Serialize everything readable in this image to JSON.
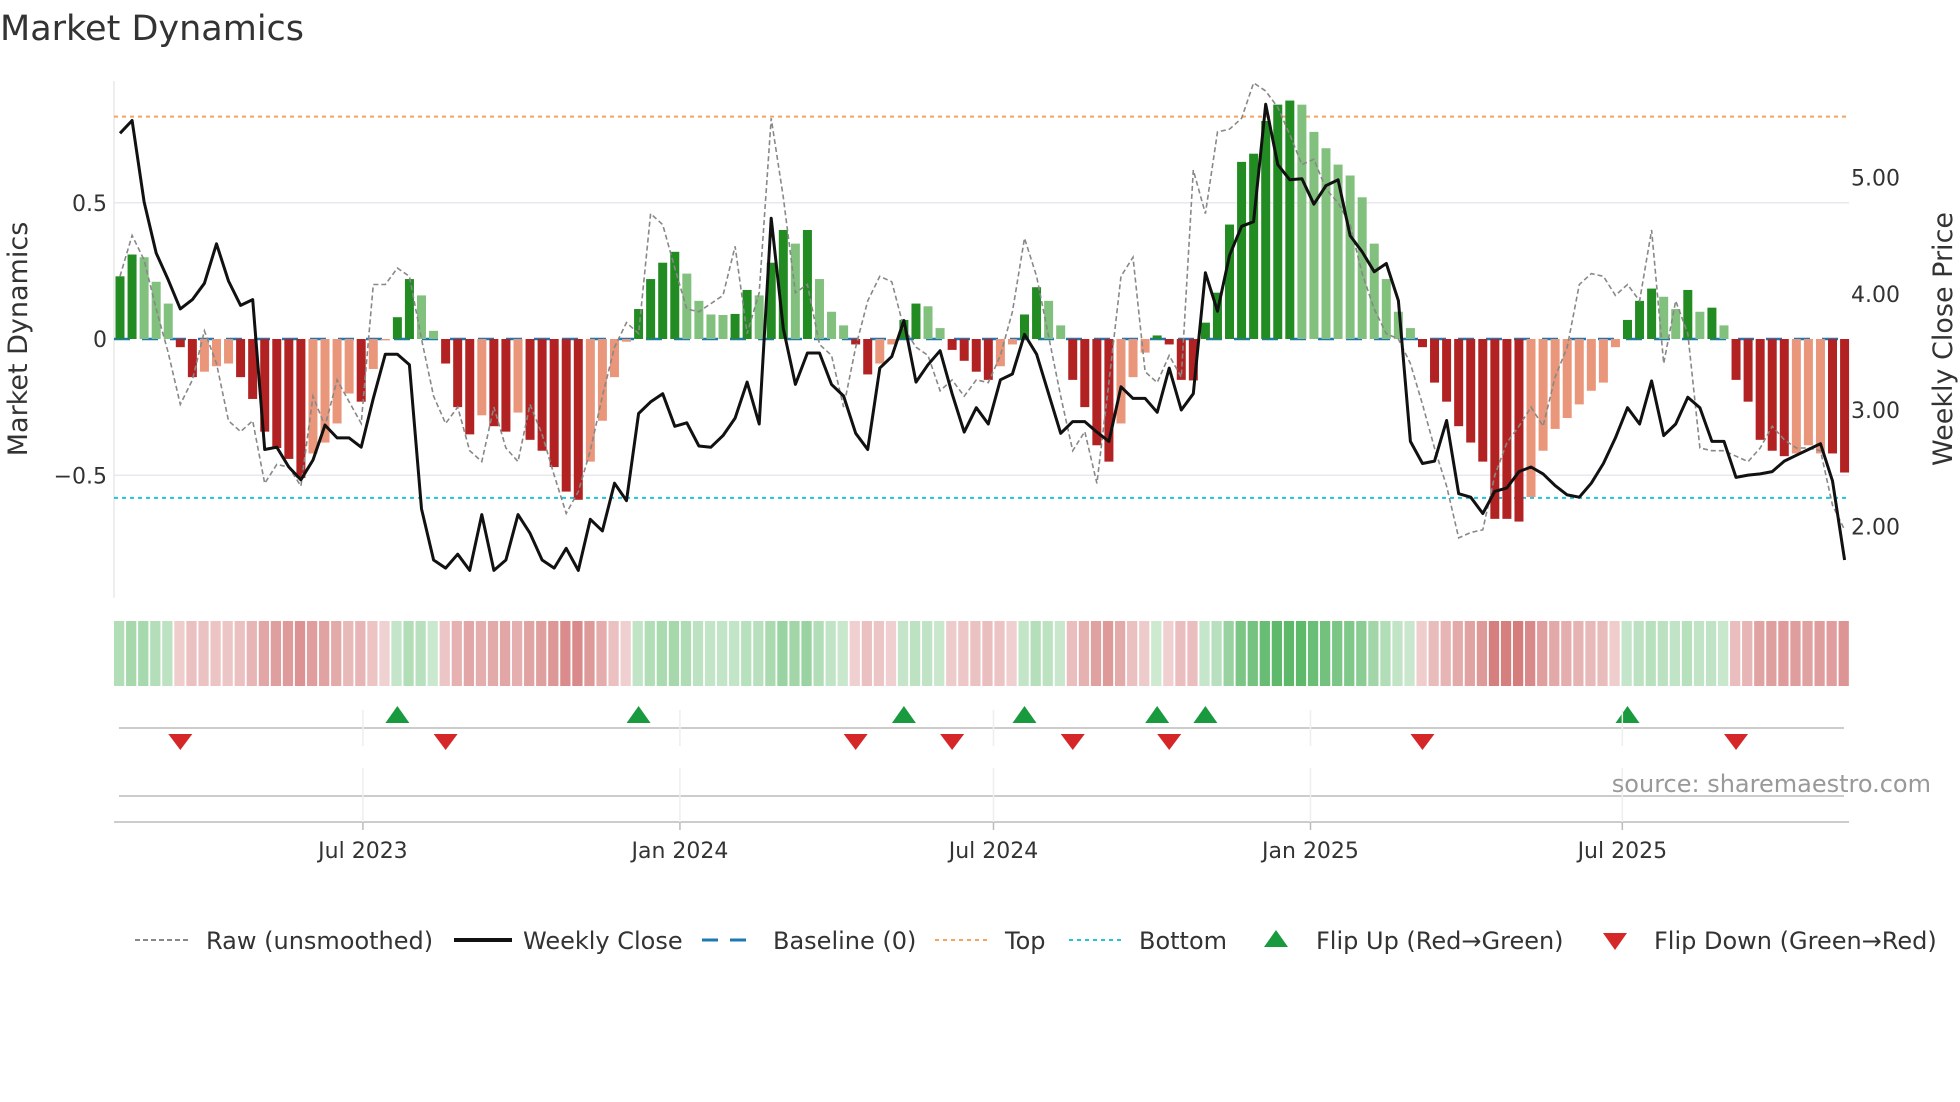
{
  "chart_data": {
    "type": "bar",
    "title": "Market Dynamics",
    "ylabel": "Market Dynamics",
    "y2label": "Weekly Close Price",
    "ylim": [
      -0.95,
      0.95
    ],
    "y2lim": [
      1.5,
      5.9
    ],
    "x_start": "2023-02-10",
    "x_step_days": 7,
    "y_ticks": [
      {
        "v": 0.5,
        "label": "0.5"
      },
      {
        "v": 0,
        "label": "0"
      },
      {
        "v": -0.5,
        "label": "−0.5"
      }
    ],
    "y2_ticks": [
      {
        "v": 5,
        "label": "5.00"
      },
      {
        "v": 4,
        "label": "4.00"
      },
      {
        "v": 3,
        "label": "3.00"
      },
      {
        "v": 2,
        "label": "2.00"
      }
    ],
    "x_ticks": [
      {
        "date": "2023-07-01",
        "label": "Jul 2023"
      },
      {
        "date": "2024-01-01",
        "label": "Jan 2024"
      },
      {
        "date": "2024-07-01",
        "label": "Jul 2024"
      },
      {
        "date": "2025-01-01",
        "label": "Jan 2025"
      },
      {
        "date": "2025-07-01",
        "label": "Jul 2025"
      }
    ],
    "top_level": 0.816,
    "bottom_level": -0.583,
    "baseline": 0,
    "momentum": [
      0.23,
      0.31,
      0.3,
      0.21,
      0.13,
      -0.03,
      -0.14,
      -0.12,
      -0.1,
      -0.09,
      -0.14,
      -0.22,
      -0.34,
      -0.4,
      -0.44,
      -0.51,
      -0.42,
      -0.38,
      -0.31,
      -0.2,
      -0.23,
      -0.11,
      -0.005,
      0.08,
      0.22,
      0.16,
      0.03,
      -0.09,
      -0.25,
      -0.35,
      -0.28,
      -0.32,
      -0.34,
      -0.27,
      -0.37,
      -0.41,
      -0.47,
      -0.56,
      -0.59,
      -0.45,
      -0.3,
      -0.14,
      -0.01,
      0.11,
      0.22,
      0.28,
      0.32,
      0.24,
      0.14,
      0.09,
      0.088,
      0.092,
      0.18,
      0.16,
      0.28,
      0.4,
      0.35,
      0.4,
      0.22,
      0.1,
      0.05,
      -0.02,
      -0.13,
      -0.09,
      -0.02,
      0.07,
      0.13,
      0.12,
      0.04,
      -0.04,
      -0.08,
      -0.12,
      -0.15,
      -0.1,
      -0.02,
      0.09,
      0.19,
      0.14,
      0.05,
      -0.15,
      -0.25,
      -0.39,
      -0.45,
      -0.31,
      -0.14,
      -0.05,
      0.013,
      -0.02,
      -0.15,
      -0.152,
      0.06,
      0.17,
      0.42,
      0.65,
      0.68,
      0.8,
      0.86,
      0.875,
      0.86,
      0.76,
      0.7,
      0.64,
      0.6,
      0.52,
      0.35,
      0.22,
      0.1,
      0.04,
      -0.03,
      -0.16,
      -0.23,
      -0.32,
      -0.38,
      -0.45,
      -0.66,
      -0.66,
      -0.67,
      -0.58,
      -0.41,
      -0.33,
      -0.29,
      -0.24,
      -0.19,
      -0.16,
      -0.03,
      0.07,
      0.14,
      0.185,
      0.155,
      0.11,
      0.18,
      0.1,
      0.115,
      0.05,
      -0.15,
      -0.23,
      -0.37,
      -0.41,
      -0.43,
      -0.42,
      -0.39,
      -0.42,
      -0.42,
      -0.49
    ],
    "shade": "DDLLLDDLLLDDDDDDLLLLDLLDDLLDDDLDDLDDDDDLLLLDDDDLLLLDDLDDLDLLLDDLLDDLLDDDDLLDDLLDDDDLLLDDDDDDDDDDDDLLLLLLLLLLDDDDDDDDDLLLLLLLLDDDLLDLDLDDDDDLLLDD",
    "raw": [
      0.23,
      0.38,
      0.29,
      0.11,
      -0.05,
      -0.24,
      -0.15,
      0.03,
      -0.09,
      -0.3,
      -0.34,
      -0.3,
      -0.53,
      -0.46,
      -0.47,
      -0.54,
      -0.21,
      -0.32,
      -0.15,
      -0.23,
      -0.31,
      0.2,
      0.2,
      0.26,
      0.23,
      0.0,
      -0.21,
      -0.31,
      -0.25,
      -0.41,
      -0.45,
      -0.25,
      -0.4,
      -0.45,
      -0.24,
      -0.35,
      -0.5,
      -0.64,
      -0.56,
      -0.41,
      -0.21,
      -0.03,
      0.06,
      0.02,
      0.46,
      0.42,
      0.26,
      0.11,
      0.1,
      0.13,
      0.16,
      0.34,
      0.02,
      0.17,
      0.81,
      0.52,
      0.17,
      0.2,
      -0.02,
      -0.06,
      -0.25,
      -0.03,
      0.14,
      0.23,
      0.21,
      0.04,
      -0.03,
      -0.06,
      -0.19,
      -0.15,
      -0.21,
      -0.15,
      -0.16,
      -0.06,
      0.1,
      0.37,
      0.23,
      0.01,
      -0.21,
      -0.41,
      -0.34,
      -0.53,
      -0.16,
      0.23,
      0.3,
      -0.12,
      -0.16,
      -0.06,
      -0.14,
      0.62,
      0.46,
      0.76,
      0.77,
      0.81,
      0.94,
      0.91,
      0.85,
      0.75,
      0.64,
      0.66,
      0.55,
      0.5,
      0.42,
      0.24,
      0.11,
      0.02,
      0.0,
      -0.09,
      -0.24,
      -0.4,
      -0.54,
      -0.73,
      -0.71,
      -0.7,
      -0.5,
      -0.38,
      -0.32,
      -0.25,
      -0.32,
      -0.14,
      -0.03,
      0.2,
      0.24,
      0.23,
      0.16,
      0.2,
      0.14,
      0.4,
      -0.09,
      0.14,
      0.02,
      -0.4,
      -0.41,
      -0.41,
      -0.43,
      -0.45,
      -0.4,
      -0.32,
      -0.37,
      -0.4,
      -0.4,
      -0.41,
      -0.61,
      -0.7
    ],
    "weekly_close": [
      5.38,
      5.49,
      4.79,
      4.35,
      4.12,
      3.87,
      3.95,
      4.09,
      4.43,
      4.11,
      3.9,
      3.95,
      2.66,
      2.68,
      2.51,
      2.4,
      2.57,
      2.87,
      2.76,
      2.76,
      2.68,
      3.1,
      3.48,
      3.48,
      3.39,
      2.15,
      1.71,
      1.64,
      1.76,
      1.62,
      2.1,
      1.62,
      1.71,
      2.1,
      1.94,
      1.71,
      1.64,
      1.81,
      1.62,
      2.06,
      1.96,
      2.37,
      2.22,
      2.97,
      3.07,
      3.14,
      2.86,
      2.89,
      2.69,
      2.68,
      2.78,
      2.93,
      3.24,
      2.88,
      4.65,
      3.7,
      3.22,
      3.49,
      3.49,
      3.22,
      3.12,
      2.8,
      2.66,
      3.36,
      3.46,
      3.77,
      3.24,
      3.39,
      3.51,
      3.14,
      2.81,
      3.02,
      2.88,
      3.26,
      3.31,
      3.65,
      3.48,
      3.14,
      2.8,
      2.9,
      2.9,
      2.81,
      2.73,
      3.2,
      3.1,
      3.1,
      2.98,
      3.36,
      3.0,
      3.14,
      4.18,
      3.85,
      4.33,
      4.58,
      4.62,
      5.63,
      5.11,
      4.98,
      4.99,
      4.77,
      4.93,
      4.98,
      4.5,
      4.36,
      4.19,
      4.26,
      3.94,
      2.73,
      2.54,
      2.56,
      2.91,
      2.28,
      2.25,
      2.11,
      2.3,
      2.33,
      2.47,
      2.51,
      2.45,
      2.35,
      2.27,
      2.25,
      2.37,
      2.54,
      2.76,
      3.02,
      2.88,
      3.25,
      2.78,
      2.88,
      3.11,
      3.02,
      2.73,
      2.73,
      2.42,
      2.44,
      2.45,
      2.47,
      2.56,
      2.61,
      2.66,
      2.71,
      2.39,
      1.71
    ],
    "flip_up_weeks": [
      23,
      43,
      65,
      75,
      86,
      90,
      125
    ],
    "flip_down_weeks": [
      5,
      27,
      61,
      69,
      79,
      87,
      108,
      134
    ],
    "legend": {
      "placement": "bottom",
      "items": [
        {
          "key": "raw",
          "label": "Raw (unsmoothed)"
        },
        {
          "key": "close",
          "label": "Weekly Close"
        },
        {
          "key": "baseline",
          "label": "Baseline (0)"
        },
        {
          "key": "top",
          "label": "Top"
        },
        {
          "key": "bottom",
          "label": "Bottom"
        },
        {
          "key": "flip_up",
          "label": "Flip Up (Red→Green)"
        },
        {
          "key": "flip_down",
          "label": "Flip Down (Green→Red)"
        }
      ]
    },
    "source": "source: sharemaestro.com",
    "colors": {
      "pos_dark": "#228b22",
      "pos_light": "#82c07e",
      "neg_dark": "#b22222",
      "neg_light": "#e9967a",
      "baseline": "#1f77b4",
      "top": "#f4a460",
      "bottom": "#22c4d8",
      "raw": "#888888",
      "close": "#111111",
      "flip_up": "#1a9a3f",
      "flip_down": "#d62728"
    }
  }
}
